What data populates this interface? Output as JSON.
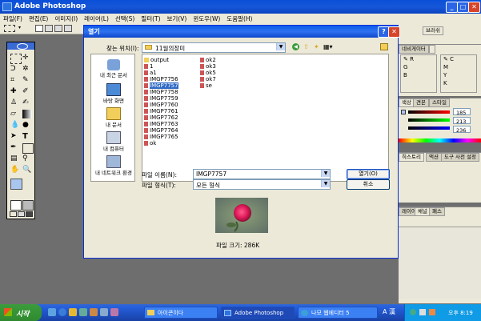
{
  "app": {
    "title": "Adobe Photoshop",
    "menu": [
      "파일(F)",
      "편집(E)",
      "이미지(I)",
      "레이어(L)",
      "선택(S)",
      "필터(T)",
      "보기(V)",
      "윈도우(W)",
      "도움말(H)"
    ]
  },
  "dialog": {
    "title": "열기",
    "look_in_label": "찾는 위치(I):",
    "look_in_value": "11월의장미",
    "places": [
      "내 최근 문서",
      "바탕 화면",
      "내 문서",
      "내 컴퓨터",
      "내 네트워크 환경"
    ],
    "files_col1": [
      "output",
      "1",
      "a1",
      "IMGP7756",
      "IMGP7757",
      "IMGP7758",
      "IMGP7759",
      "IMGP7760",
      "IMGP7761",
      "IMGP7762",
      "IMGP7763",
      "IMGP7764",
      "IMGP7765",
      "ok"
    ],
    "files_col2": [
      "ok2",
      "ok3",
      "ok5",
      "ok7",
      "se"
    ],
    "selected_file": "IMGP7757",
    "filename_label": "파일 이름(N):",
    "filename_value": "IMGP7757",
    "filetype_label": "파일 형식(T):",
    "filetype_value": "모든 형식",
    "open_button": "열기(O)",
    "cancel_button": "취소",
    "filesize_text": "파일 크기: 286K"
  },
  "panels": {
    "navigator_tabs": [
      "네비게이터",
      "정보"
    ],
    "color_tabs": [
      "색상",
      "견본",
      "스타일"
    ],
    "color_values": [
      "185",
      "213",
      "236"
    ],
    "history_tabs": [
      "히스토리",
      "액션",
      "도구 사전 설정"
    ],
    "layers_tabs": [
      "레이어",
      "채널",
      "패스"
    ],
    "brushes_tab": "브러쉬"
  },
  "taskbar": {
    "start_label": "시작",
    "tasks": [
      "아이콘이다",
      "Adobe Photoshop",
      "나모 웹에디터 5"
    ],
    "clock": "오후 8:19",
    "ime": "A 漢"
  },
  "colors": {
    "title_blue": "#0a4fd8",
    "desktop_gray": "#6e6e6e",
    "selection": "#316ac5",
    "start_green": "#3c9c3c"
  }
}
